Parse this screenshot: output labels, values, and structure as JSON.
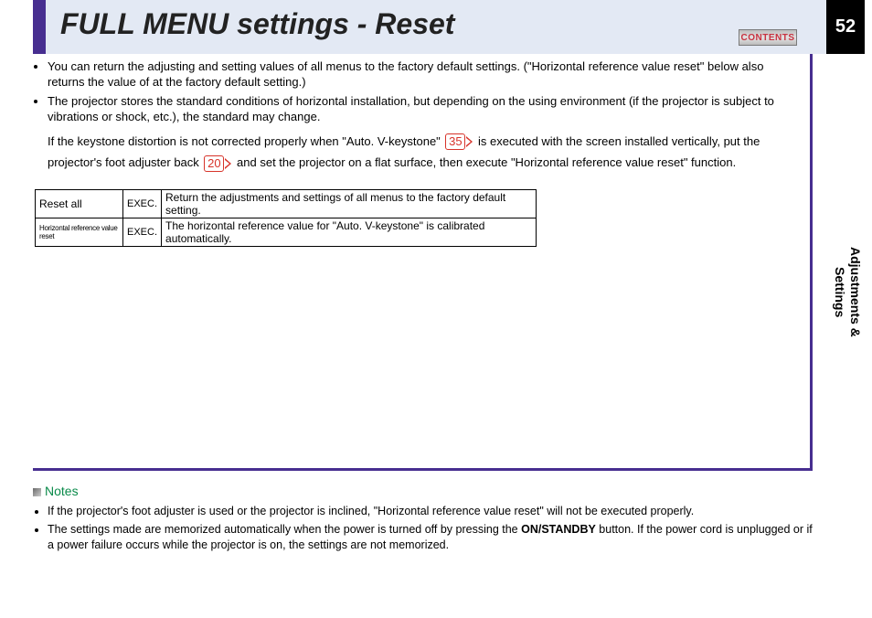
{
  "header": {
    "title": "FULL MENU settings - Reset",
    "contents_label": "CONTENTS",
    "page_number": "52"
  },
  "intro_bullets": [
    "You can return the adjusting and setting values of all menus to the factory default settings. (\"Horizontal reference value reset\" below also returns the value of at the factory default setting.)",
    "The projector stores the standard conditions of horizontal installation, but depending on the using environment (if the projector is subject to vibrations or shock, etc.), the standard may change."
  ],
  "keystone_para": {
    "p1": "If the keystone distortion is not corrected properly when \"Auto. V-keystone\" ",
    "ref1": "35",
    "p2": " is executed with the screen installed vertically, put the projector's foot adjuster back ",
    "ref2": "20",
    "p3": " and set the projector on a flat surface, then execute \"Horizontal reference value reset\" function."
  },
  "reset_table": [
    {
      "name": "Reset all",
      "exec": "EXEC.",
      "desc": "Return the adjustments and settings of all menus to the factory default setting."
    },
    {
      "name": "Horizontal reference value reset",
      "exec": "EXEC.",
      "desc": "The horizontal reference value for \"Auto. V-keystone\" is calibrated automatically."
    }
  ],
  "side_tab": "Adjustments &\nSettings",
  "notes": {
    "heading": "Notes",
    "items": [
      {
        "pre": "If the projector's foot adjuster is used or the projector is inclined, \"Horizontal reference value reset\" will not be executed properly.",
        "bold": "",
        "post": ""
      },
      {
        "pre": "The settings made are memorized automatically when the power is turned off by pressing the ",
        "bold": "ON/STANDBY",
        "post": " button. If the power cord is unplugged or if a power failure occurs while the projector is on, the settings are not memorized."
      }
    ]
  }
}
